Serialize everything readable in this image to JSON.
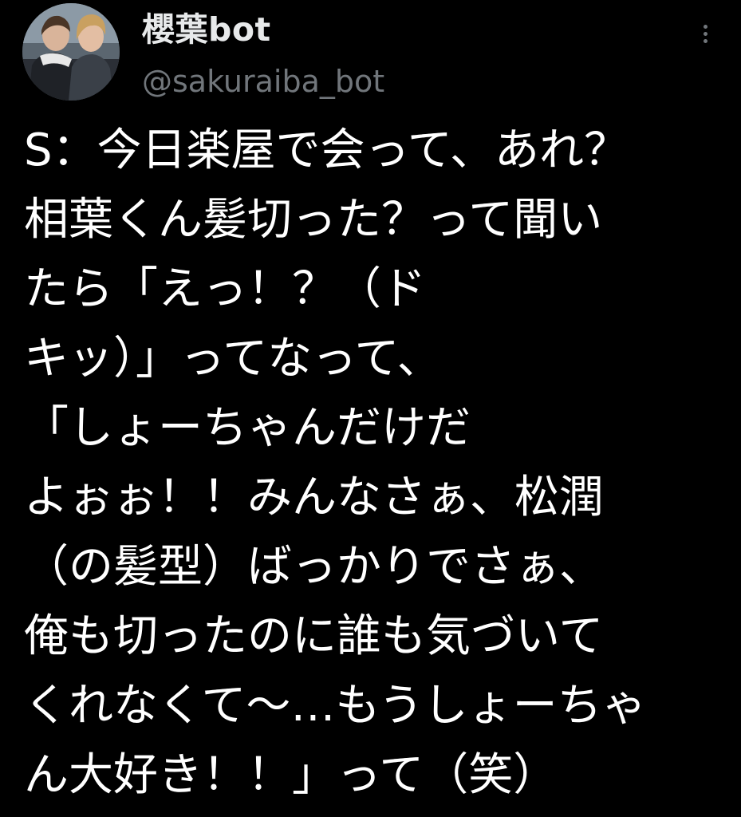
{
  "user": {
    "display_name": "櫻葉bot",
    "handle": "@sakuraiba_bot",
    "avatar_icon": "profile-photo"
  },
  "menu": {
    "icon": "more-vertical-icon"
  },
  "tweet": {
    "lines": [
      "S：今日楽屋で会って、あれ？",
      "相葉くん髪切った？って聞い",
      "たら「えっ！？（ド",
      "キッ）」ってなって、",
      "「しょーちゃんだけだ",
      "よぉぉ！！みんなさぁ、松潤",
      "（の髪型）ばっかりでさぁ、",
      "俺も切ったのに誰も気づいて",
      "くれなくて〜…もうしょーちゃ",
      "ん大好き！！」って（笑）"
    ]
  },
  "colors": {
    "background": "#000000",
    "text_primary": "#ffffff",
    "text_secondary": "#71767b"
  }
}
